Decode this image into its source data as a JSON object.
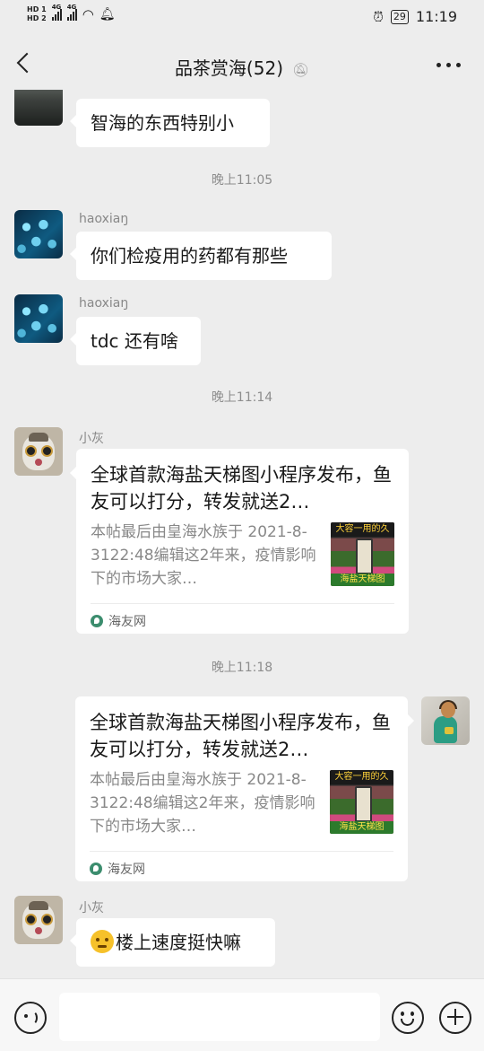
{
  "status_bar": {
    "hd1": "HD 1",
    "hd2": "HD 2",
    "net1": "4G",
    "net2": "4G",
    "battery": "29",
    "time": "11:19"
  },
  "header": {
    "title": "品茶赏海(52)",
    "back_icon": "chevron-left-icon",
    "mute_icon": "bell-muted-icon",
    "more_icon": "more-dots-icon"
  },
  "messages": [
    {
      "type": "text",
      "side": "left",
      "text": "智海的东西特别小"
    },
    {
      "type": "time",
      "text": "晚上11:05"
    },
    {
      "type": "text",
      "side": "left",
      "sender": "haoxiaŋ",
      "text": "你们检疫用的药都有那些"
    },
    {
      "type": "text",
      "side": "left",
      "sender": "haoxiaŋ",
      "text": "tdc 还有啥"
    },
    {
      "type": "time",
      "text": "晚上11:14"
    },
    {
      "type": "link_card",
      "side": "left",
      "sender": "小灰",
      "title": "全球首款海盐天梯图小程序发布，鱼友可以打分，转发就送2…",
      "description": "本帖最后由皇海水族于 2021-8-3122:48编辑这2年来，疫情影响下的市场大家…",
      "thumb_top": "大容一用的久",
      "thumb_bottom": "海盐天梯图",
      "source": "海友网"
    },
    {
      "type": "time",
      "text": "晚上11:18"
    },
    {
      "type": "link_card",
      "side": "right",
      "title": "全球首款海盐天梯图小程序发布，鱼友可以打分，转发就送2…",
      "description": "本帖最后由皇海水族于 2021-8-3122:48编辑这2年来，疫情影响下的市场大家…",
      "thumb_top": "大容一用的久",
      "thumb_bottom": "海盐天梯图",
      "source": "海友网"
    },
    {
      "type": "text",
      "side": "left",
      "sender": "小灰",
      "emoji": "thinking-emoji",
      "text": "楼上速度挺快嘛"
    }
  ],
  "input_bar": {
    "placeholder": "",
    "voice_icon": "voice-icon",
    "emoji_icon": "emoji-icon",
    "plus_icon": "plus-icon"
  }
}
